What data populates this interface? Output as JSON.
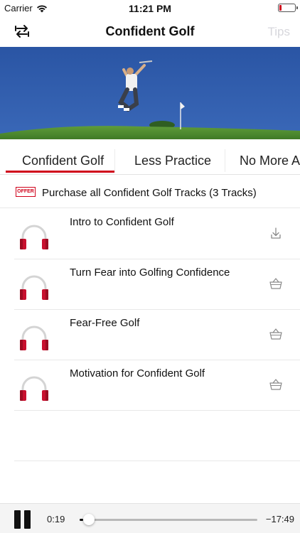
{
  "status_bar": {
    "carrier": "Carrier",
    "time": "11:21 PM",
    "battery_level": 0.12
  },
  "nav": {
    "title": "Confident Golf",
    "right_button": "Tips",
    "left_icon": "sync-arrows-icon"
  },
  "tabs": [
    {
      "label": "Confident Golf",
      "selected": true
    },
    {
      "label": "Less Practice",
      "selected": false
    },
    {
      "label": "No More Anger",
      "selected": false
    }
  ],
  "offer": {
    "badge": "OFFER",
    "text": "Purchase all Confident Golf Tracks (3 Tracks)"
  },
  "tracks": [
    {
      "title": "Intro to Confident Golf",
      "action_icon": "download-icon"
    },
    {
      "title": "Turn Fear into Golfing Confidence",
      "action_icon": "basket-icon"
    },
    {
      "title": "Fear-Free Golf",
      "action_icon": "basket-icon"
    },
    {
      "title": "Motivation for Confident Golf",
      "action_icon": "basket-icon"
    }
  ],
  "player": {
    "elapsed": "0:19",
    "remaining": "−17:49",
    "progress": 0.018
  },
  "colors": {
    "accent": "#d0021b",
    "sky": "#2d5aa9",
    "grass": "#4c8a2f",
    "inactive_text": "#d7d7dc"
  }
}
